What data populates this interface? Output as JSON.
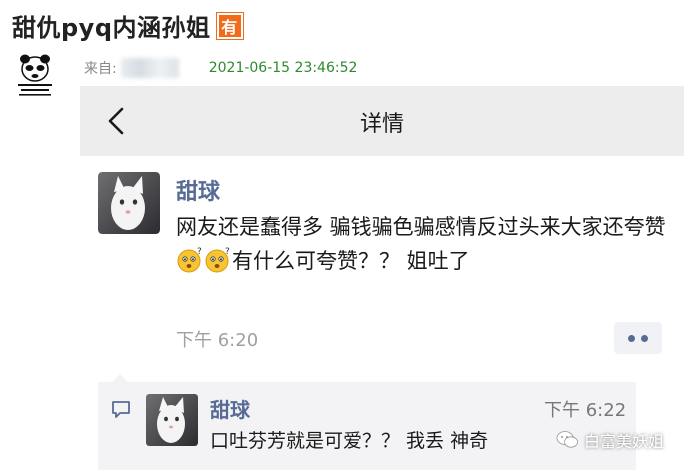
{
  "post": {
    "title": "甜仇pyq内涵孙姐",
    "badge": "有",
    "from_label": "来自:",
    "date": "2021-06-15 23:46:52"
  },
  "nav": {
    "title": "详情",
    "back_icon": "chevron-left-icon"
  },
  "moment": {
    "author": "甜球",
    "text_part1": "网友还是蠢得多 骗钱骗色骗感情反过头来大家还夸赞",
    "emoji": "confused-face-emoji",
    "text_part2": "有什么可夸赞？？ 姐吐了",
    "time": "下午 6:20"
  },
  "comment": {
    "author": "甜球",
    "time": "下午 6:22",
    "text": "口吐芬芳就是可爱？？ 我丢 神奇"
  },
  "watermark": {
    "text": "白富美妖姐"
  },
  "colors": {
    "badge_orange": "#f26b1d",
    "date_green": "#2f8a2f",
    "name_blue": "#576b95",
    "nav_gray": "#ededed"
  }
}
